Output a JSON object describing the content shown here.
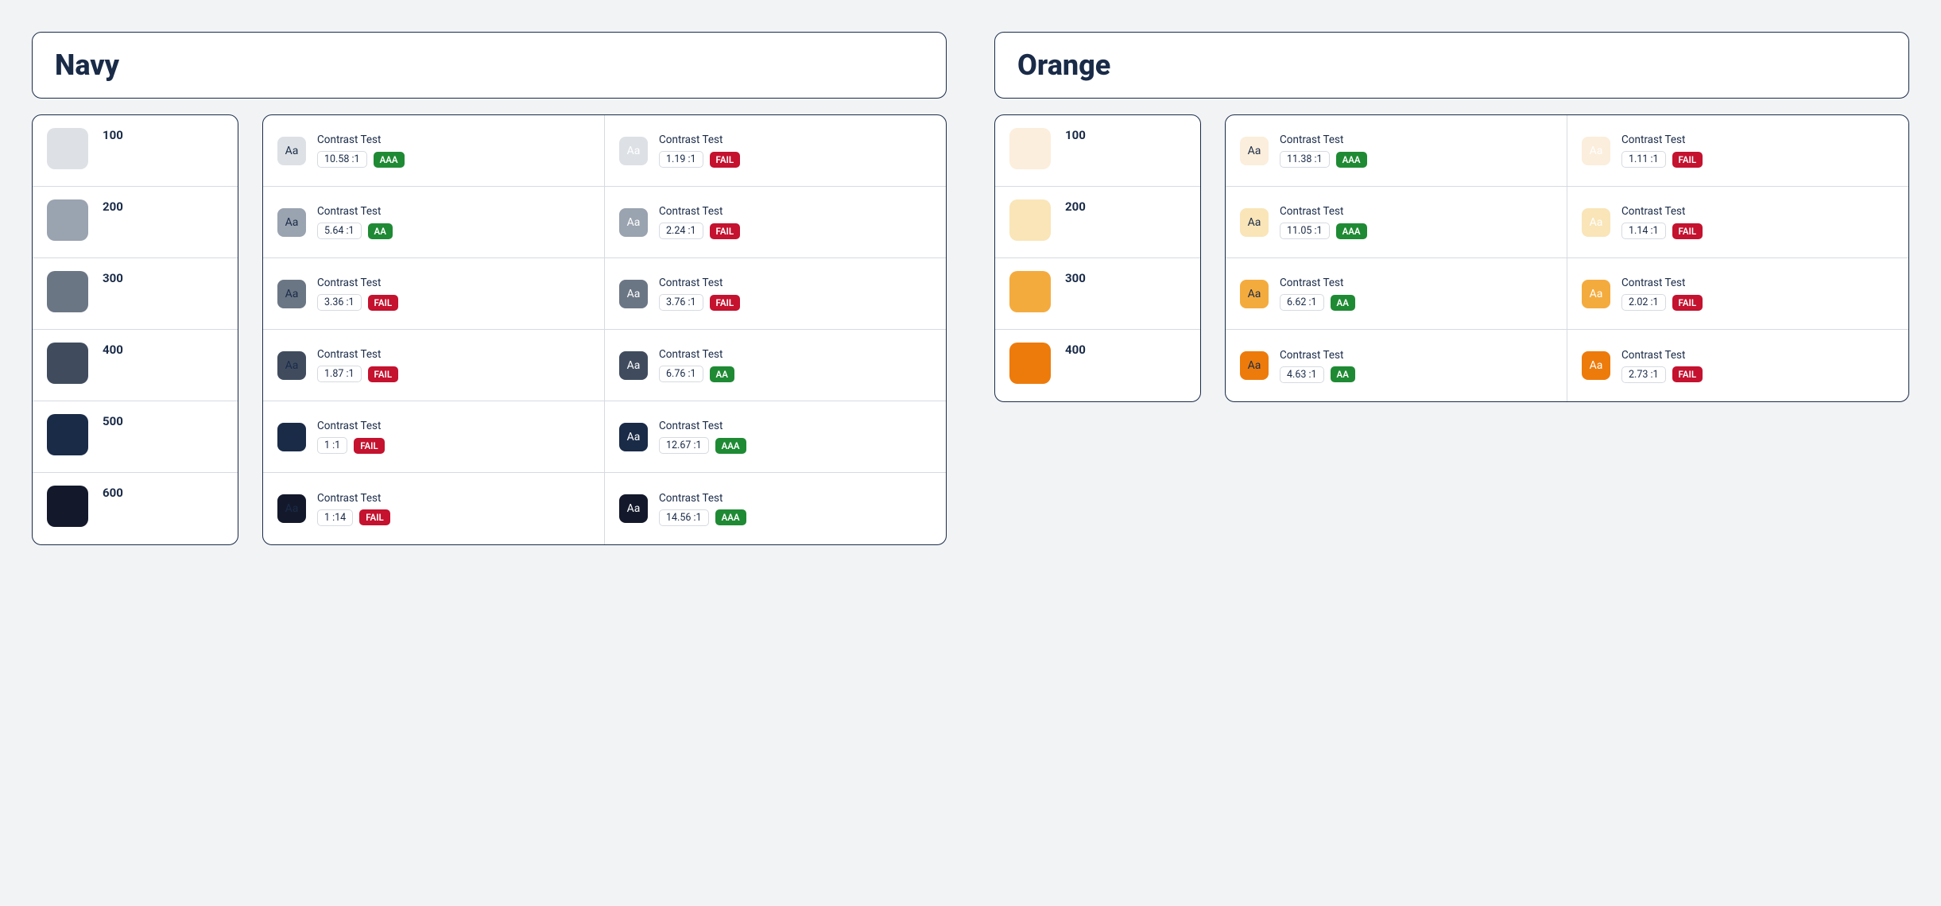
{
  "labels": {
    "contrast_test": "Contrast Test",
    "sample": "Aa",
    "aaa": "AAA",
    "aa": "AA",
    "fail": "FAIL"
  },
  "families": [
    {
      "name": "Navy",
      "shades": [
        {
          "label": "100",
          "hex": "#dde1e5",
          "dark_ratio": "10.58 :1",
          "dark_badge": "AAA",
          "light_ratio": "1.19 :1",
          "light_badge": "FAIL"
        },
        {
          "label": "200",
          "hex": "#9aa3b0",
          "dark_ratio": "5.64 :1",
          "dark_badge": "AA",
          "light_ratio": "2.24 :1",
          "light_badge": "FAIL"
        },
        {
          "label": "300",
          "hex": "#6b7685",
          "dark_ratio": "3.36 :1",
          "dark_badge": "FAIL",
          "light_ratio": "3.76 :1",
          "light_badge": "FAIL"
        },
        {
          "label": "400",
          "hex": "#404c5e",
          "dark_ratio": "1.87 :1",
          "dark_badge": "FAIL",
          "light_ratio": "6.76 :1",
          "light_badge": "AA"
        },
        {
          "label": "500",
          "hex": "#1A2B48",
          "dark_ratio": "1 :1",
          "dark_badge": "FAIL",
          "light_ratio": "12.67 :1",
          "light_badge": "AAA"
        },
        {
          "label": "600",
          "hex": "#13192b",
          "dark_ratio": "1 :14",
          "dark_badge": "FAIL",
          "light_ratio": "14.56 :1",
          "light_badge": "AAA"
        }
      ]
    },
    {
      "name": "Orange",
      "shades": [
        {
          "label": "100",
          "hex": "#fbeedc",
          "dark_ratio": "11.38 :1",
          "dark_badge": "AAA",
          "light_ratio": "1.11 :1",
          "light_badge": "FAIL"
        },
        {
          "label": "200",
          "hex": "#f9e5b8",
          "dark_ratio": "11.05 :1",
          "dark_badge": "AAA",
          "light_ratio": "1.14 :1",
          "light_badge": "FAIL"
        },
        {
          "label": "300",
          "hex": "#f4ab3e",
          "dark_ratio": "6.62 :1",
          "dark_badge": "AA",
          "light_ratio": "2.02 :1",
          "light_badge": "FAIL"
        },
        {
          "label": "400",
          "hex": "#ec7b0c",
          "dark_ratio": "4.63 :1",
          "dark_badge": "AA",
          "light_ratio": "2.73 :1",
          "light_badge": "FAIL"
        }
      ]
    }
  ]
}
